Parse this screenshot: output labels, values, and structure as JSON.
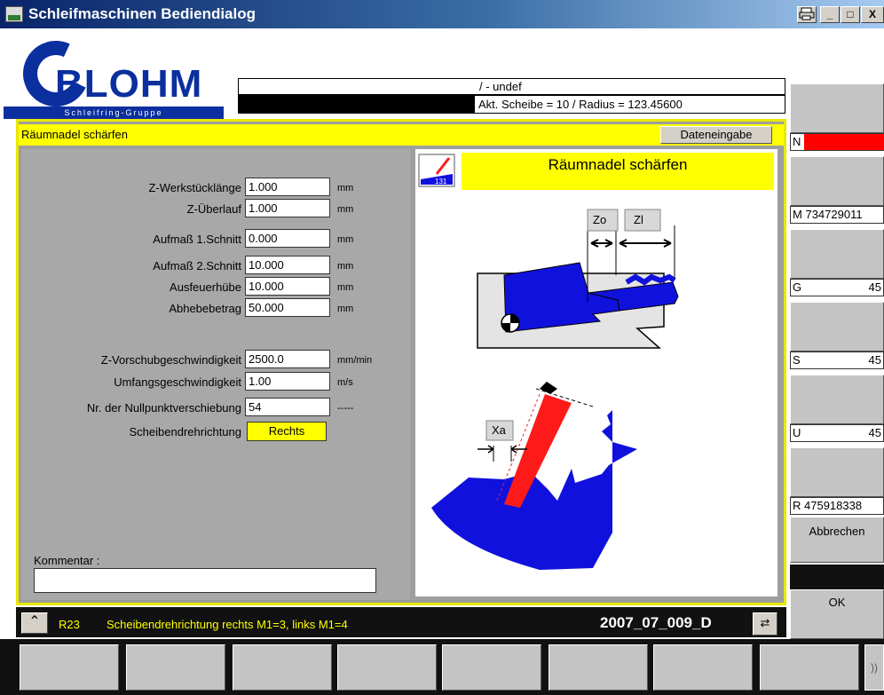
{
  "window": {
    "title": "Schleifmaschinen Bediendialog",
    "controls": [
      "print",
      "_",
      "□",
      "X"
    ]
  },
  "logo": {
    "brand": "BLOHM",
    "subtitle": "Schleifring-Gruppe"
  },
  "header": {
    "line1": "/ - undef",
    "line2": "Akt. Scheibe = 10  / Radius = 123.45600"
  },
  "frame": {
    "title": "Räumnadel schärfen",
    "mode_button": "Dateneingabe"
  },
  "form": {
    "fields": [
      {
        "label": "Z-Werkstücklänge",
        "value": "1.000",
        "unit": "mm"
      },
      {
        "label": "Z-Überlauf",
        "value": "1.000",
        "unit": "mm"
      },
      {
        "label": "Aufmaß 1.Schnitt",
        "value": "0.000",
        "unit": "mm"
      },
      {
        "label": "Aufmaß 2.Schnitt",
        "value": "10.000",
        "unit": "mm"
      },
      {
        "label": "Ausfeuerhübe",
        "value": "10.000",
        "unit": "mm"
      },
      {
        "label": "Abhebebetrag",
        "value": "50.000",
        "unit": "mm"
      }
    ],
    "fields2": [
      {
        "label": "Z-Vorschubgeschwindigkeit",
        "value": "2500.0",
        "unit": "mm/min"
      },
      {
        "label": "Umfangsgeschwindigkeit",
        "value": "1.00",
        "unit": "m/s"
      },
      {
        "label": "Nr. der Nullpunktverschiebung",
        "value": "54",
        "unit": "-----"
      }
    ],
    "direction": {
      "label": "Scheibendrehrichtung",
      "value": "Rechts"
    },
    "comment": {
      "label": "Kommentar   :",
      "value": ""
    }
  },
  "illustration": {
    "title": "Räumnadel schärfen",
    "labels": {
      "zo": "Zo",
      "zl": "Zl",
      "xa": "Xa"
    },
    "colors": {
      "part": "#1111dd",
      "wheel": "#ff1a1a",
      "highlight": "#ffff00"
    }
  },
  "right_panel": {
    "fields": [
      {
        "key": "N",
        "value": ""
      },
      {
        "key": "M",
        "value": "734729011"
      },
      {
        "key": "G",
        "value": "45"
      },
      {
        "key": "S",
        "value": "45"
      },
      {
        "key": "U",
        "value": "45"
      },
      {
        "key": "R",
        "value": "475918338"
      }
    ],
    "cancel": "Abbrechen",
    "ok": "OK"
  },
  "status": {
    "code": "R23",
    "message": "Scheibendrehrichtung rechts M1=3,  links M1=4",
    "id": "2007_07_009_D"
  },
  "softkeys": [
    "",
    "",
    "",
    "",
    "",
    "",
    "",
    ""
  ],
  "softkey_more": "))"
}
